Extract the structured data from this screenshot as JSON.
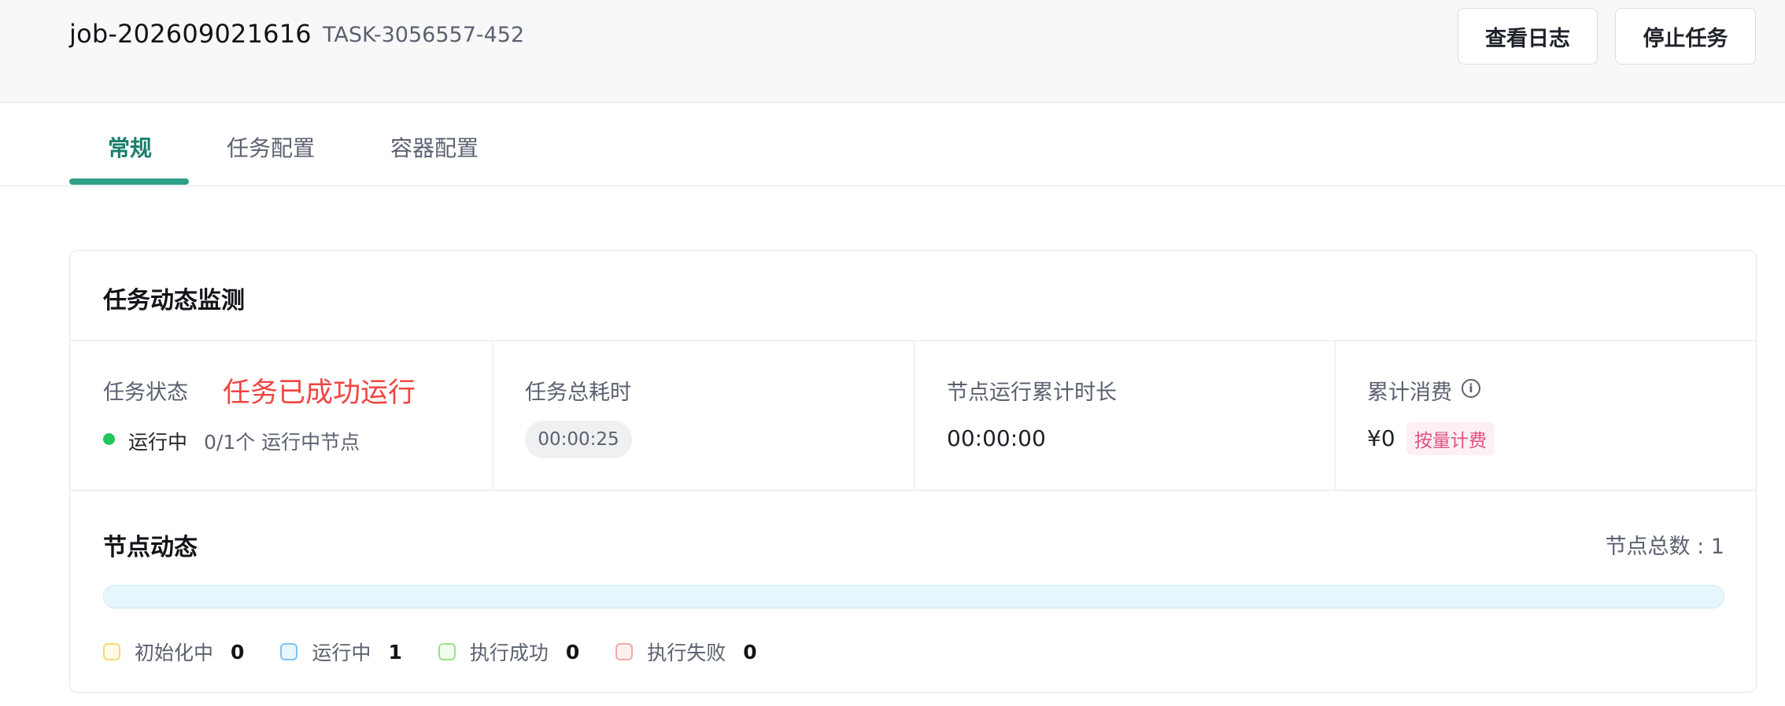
{
  "header": {
    "job_name": "job-202609021616",
    "task_id": "TASK-3056557-452",
    "view_logs_label": "查看日志",
    "stop_task_label": "停止任务"
  },
  "tabs": [
    {
      "label": "常规",
      "active": true
    },
    {
      "label": "任务配置",
      "active": false
    },
    {
      "label": "容器配置",
      "active": false
    }
  ],
  "monitor": {
    "title": "任务动态监测",
    "task_status_label": "任务状态",
    "task_status_value": "任务已成功运行",
    "running_label": "运行中",
    "running_nodes_text": "0/1个 运行中节点",
    "total_duration_label": "任务总耗时",
    "total_duration_value": "00:00:25",
    "node_runtime_label": "节点运行累计时长",
    "node_runtime_value": "00:00:00",
    "cost_label": "累计消费",
    "cost_info_icon": "info-icon",
    "cost_value": "¥0",
    "billing_badge": "按量计费"
  },
  "nodes": {
    "title": "节点动态",
    "total_text": "节点总数 : 1",
    "progress_fraction": 1.0,
    "legend": [
      {
        "label": "初始化中",
        "count": "0",
        "color": "#f5d77a",
        "bg": "#fffbe8"
      },
      {
        "label": "运行中",
        "count": "1",
        "color": "#7cc3ef",
        "bg": "#eaf6fd"
      },
      {
        "label": "执行成功",
        "count": "0",
        "color": "#9ee08a",
        "bg": "#f1fbee"
      },
      {
        "label": "执行失败",
        "count": "0",
        "color": "#f3a9a6",
        "bg": "#fdf1f0"
      }
    ]
  },
  "colors": {
    "accent": "#2ea089",
    "status_red": "#f04542",
    "running_dot": "#22c55e",
    "progress_bg": "#e6f6fd"
  }
}
